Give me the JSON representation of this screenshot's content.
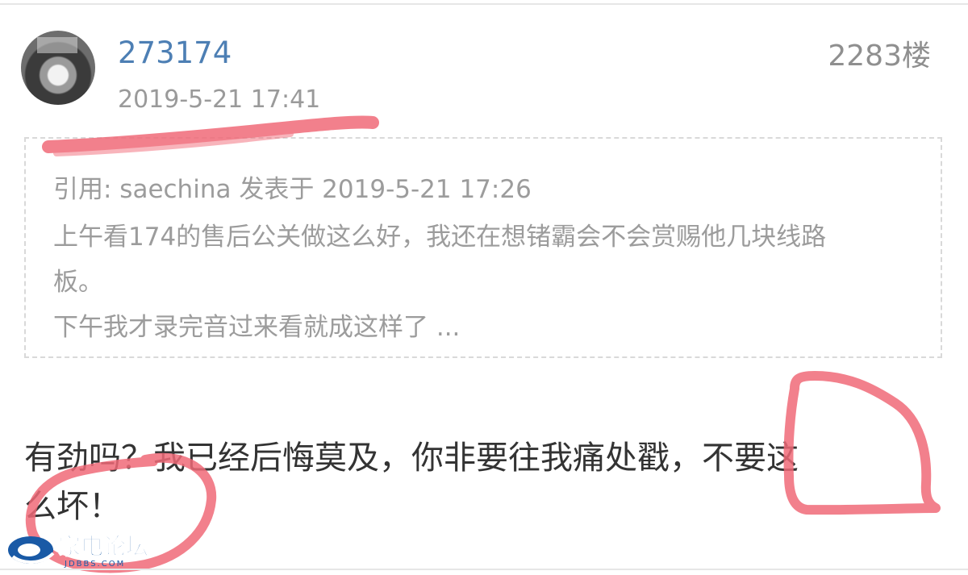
{
  "post": {
    "username": "273174",
    "timestamp": "2019-5-21 17:41",
    "floor": "2283楼",
    "quote": {
      "header": "引用: saechina 发表于 2019-5-21 17:26",
      "lines": [
        "上午看174的售后公关做这么好，我还在想锗霸会不会赏赐他几块线路",
        "板。",
        "下午我才录完音过来看就成这样了 ..."
      ]
    },
    "reply_lines": [
      "有劲吗？我已经后悔莫及，你非要往我痛处戳，不要这",
      "么坏！"
    ]
  },
  "watermark": {
    "title": "家电论坛",
    "subtitle": "JDBBS.COM"
  },
  "colors": {
    "username": "#4d7fb4",
    "meta": "#9a9a9a",
    "quote_text": "#9c9c9c",
    "reply_text": "#333333",
    "highlight_marker": "#f06a78",
    "watermark": "#1a5aa6"
  }
}
